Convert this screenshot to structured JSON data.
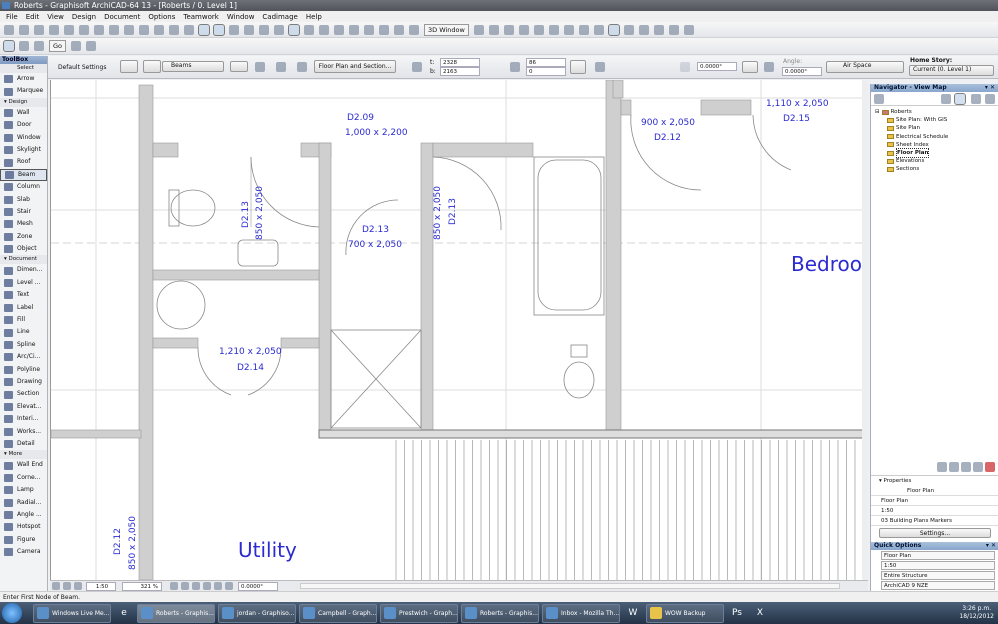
{
  "window": {
    "title": "Roberts - Graphisoft ArchiCAD-64 13 - [Roberts / 0. Level 1]"
  },
  "menu": [
    "File",
    "Edit",
    "View",
    "Design",
    "Document",
    "Options",
    "Teamwork",
    "Window",
    "Cadimage",
    "Help"
  ],
  "toolbar": {
    "window3d": "3D Window",
    "go": "Go"
  },
  "infobox": {
    "default_settings": "Default Settings",
    "layer": "Beams",
    "floorplan_section": "Floor Plan and Section...",
    "t_label": "t:",
    "t_value": "2328",
    "b_label": "b:",
    "b_value": "2163",
    "v1": "86",
    "v2": "0",
    "slope": "0.0000°",
    "angle_label": "Angle:",
    "angle_value": "0.0000°",
    "material": "Air Space",
    "home_story_label": "Home Story:",
    "home_story_value": "Current (0. Level 1)"
  },
  "toolbox": {
    "title": "ToolBox",
    "select": "Select",
    "items_top": [
      "Arrow",
      "Marquee"
    ],
    "design_label": "Design",
    "design": [
      "Wall",
      "Door",
      "Window",
      "Skylight",
      "Roof",
      "Beam",
      "Column",
      "Slab",
      "Stair",
      "Mesh",
      "Zone",
      "Object"
    ],
    "document_label": "Document",
    "document": [
      "Dimen...",
      "Level ...",
      "Text",
      "Label",
      "Fill",
      "Line",
      "Spline",
      "Arc/Ci...",
      "Polyline",
      "Drawing",
      "Section",
      "Elevat...",
      "Interi...",
      "Works...",
      "Detail"
    ],
    "more_label": "More",
    "more": [
      "Wall End",
      "Corne...",
      "Lamp",
      "Radial...",
      "Angle ...",
      "Hotspot",
      "Figure",
      "Camera"
    ]
  },
  "plan": {
    "labels": {
      "d209": "D2.09",
      "d209_size": "1,000 x 2,200",
      "d213a": "D2.13",
      "d213a_size": "850 x 2,050",
      "d213b": "D2.13",
      "d213b_size": "700 x 2,050",
      "d213c_size": "850 x 2,050",
      "d213c": "D2.13",
      "d212_size": "900 x 2,050",
      "d212": "D2.12",
      "d215_size": "1,110 x 2,050",
      "d215": "D2.15",
      "bedroom": "Bedroo",
      "d214_size": "1,210 x 2,050",
      "d214": "D2.14",
      "utility": "Utility",
      "d212b": "D2.12",
      "d212b_size": "850 x 2,050"
    }
  },
  "canvasbar": {
    "scale": "1:50",
    "zoom": "321 %",
    "angle": "0.0000°"
  },
  "navigator": {
    "title": "Navigator - View Map",
    "root": "Roberts",
    "items": [
      "Site Plan: With GIS",
      "Site Plan",
      "Electrical Schedule",
      "Sheet Index",
      "Floor Plan",
      "Elevations",
      "Sections"
    ],
    "selected": "Floor Plan",
    "properties_label": "Properties",
    "prop_name": "Floor Plan",
    "prop_rows": [
      "Floor Plan",
      "1:50",
      "03 Building Plans Markers"
    ],
    "settings": "Settings...",
    "quick_options_label": "Quick Options",
    "quick_options": [
      "Floor Plan",
      "1:50",
      "Entire Structure",
      "ArchiCAD 9 NZE"
    ]
  },
  "status": "Enter First Node of Beam.",
  "taskbar": {
    "tasks": [
      "Windows Live Me...",
      "Roberts - Graphis...",
      "jordan - Graphiso...",
      "Campbell - Graph...",
      "Prestwich - Graph...",
      "Roberts - Graphis...",
      "Inbox - Mozilla Th...",
      "WOW Backup"
    ],
    "time": "3:26 p.m.",
    "date": "18/12/2012"
  }
}
